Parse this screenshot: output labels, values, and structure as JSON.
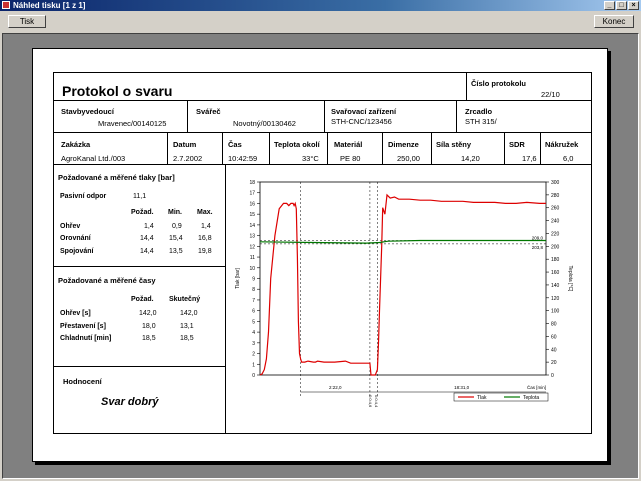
{
  "window": {
    "title": "Náhled tisku [1 z 1]",
    "print_btn": "Tisk",
    "close_btn": "Konec"
  },
  "doc": {
    "title": "Protokol o svaru",
    "protocol_no_label": "Číslo protokolu",
    "protocol_no": "22/10",
    "row1": [
      {
        "label": "Stavbyvedoucí",
        "value": "Mravenec/00140125"
      },
      {
        "label": "Svářeč",
        "value": "Novotný/00130462"
      },
      {
        "label": "Svařovací zařízení",
        "value": "STH-CNC/123456"
      },
      {
        "label": "Zrcadlo",
        "value": "STH 315/"
      }
    ],
    "row2": [
      {
        "label": "Zakázka",
        "value": "AgroKanal Ltd./003"
      },
      {
        "label": "Datum",
        "value": "2.7.2002"
      },
      {
        "label": "Čas",
        "value": "10:42:59"
      },
      {
        "label": "Teplota okolí",
        "value": "33°C"
      },
      {
        "label": "Materiál",
        "value": "PE 80"
      },
      {
        "label": "Dimenze",
        "value": "250,00"
      },
      {
        "label": "Síla stěny",
        "value": "14,20"
      },
      {
        "label": "SDR",
        "value": "17,6"
      },
      {
        "label": "Nákružek",
        "value": "6,0"
      }
    ],
    "pressures": {
      "title": "Požadované a měřené tlaky [bar]",
      "passive_label": "Pasivní odpor",
      "passive_value": "11,1",
      "headers": [
        "Požad.",
        "Min.",
        "Max."
      ],
      "rows": [
        {
          "name": "Ohřev",
          "vals": [
            "1,4",
            "0,9",
            "1,4"
          ]
        },
        {
          "name": "Orovnání",
          "vals": [
            "14,4",
            "15,4",
            "16,8"
          ]
        },
        {
          "name": "Spojování",
          "vals": [
            "14,4",
            "13,5",
            "19,8"
          ]
        }
      ]
    },
    "times": {
      "title": "Požadované a měřené časy",
      "headers": [
        "Požad.",
        "Skutečný"
      ],
      "rows": [
        {
          "name": "Ohřev [s]",
          "vals": [
            "142,0",
            "142,0"
          ]
        },
        {
          "name": "Přestavení [s]",
          "vals": [
            "18,0",
            "13,1"
          ]
        },
        {
          "name": "Chladnutí [min]",
          "vals": [
            "18,5",
            "18,5"
          ]
        }
      ]
    },
    "evaluation": {
      "title": "Hodnocení",
      "value": "Svar dobrý"
    }
  },
  "chart_data": {
    "type": "line",
    "ylabel": "Tlak [bar]",
    "y2label": "Teplota [°C]",
    "xlabel": "Čas [min]",
    "ylim": [
      0,
      18
    ],
    "y2lim": [
      0,
      300
    ],
    "yticks": [
      "0",
      "1",
      "2",
      "3",
      "4",
      "5",
      "6",
      "7",
      "8",
      "9",
      "10",
      "11",
      "12",
      "13",
      "14",
      "15",
      "16",
      "17",
      "18"
    ],
    "y2ticks": [
      "0",
      "20",
      "40",
      "60",
      "80",
      "100",
      "120",
      "140",
      "160",
      "180",
      "200",
      "220",
      "240",
      "260",
      "280",
      "300"
    ],
    "ref_labels": [
      "209,0",
      "203,8"
    ],
    "phase_labels": [
      "2:22,0",
      "0:0:4,6",
      "0:0:4,4",
      "18:31,0"
    ],
    "legend": [
      {
        "name": "Tlak",
        "color": "#dd0000"
      },
      {
        "name": "Teplota",
        "color": "#007700"
      }
    ],
    "series": [
      {
        "name": "Tlak",
        "color": "#dd0000",
        "x": [
          0,
          2,
          4,
          6,
          8,
          10,
          14,
          18,
          22,
          25,
          27,
          29,
          31,
          32,
          33,
          34,
          35,
          36,
          37,
          38,
          39,
          42,
          45,
          50,
          52,
          54,
          60,
          70,
          80,
          85,
          95,
          103,
          104,
          106,
          108,
          110,
          111,
          112,
          113,
          114,
          115,
          117,
          119,
          122,
          126,
          130,
          140,
          150,
          160,
          170,
          180,
          190,
          200,
          210,
          220,
          230,
          240,
          250,
          262,
          268
        ],
        "y": [
          0,
          0.1,
          0.5,
          1.5,
          4,
          9,
          13,
          15.5,
          16,
          16,
          15.8,
          16,
          16,
          15.8,
          16,
          15.5,
          11,
          5,
          2,
          1.5,
          1.2,
          1.2,
          1.3,
          1.2,
          1.2,
          1.3,
          1.2,
          1.2,
          1.3,
          1.1,
          1.1,
          1.1,
          0,
          0,
          0,
          0.5,
          3,
          6,
          9,
          12,
          15.6,
          15,
          16.8,
          16.5,
          16.6,
          16.4,
          16.4,
          16.3,
          16.3,
          16.2,
          16.2,
          16.2,
          16.1,
          16.1,
          16.1,
          16.0,
          16.0,
          16.1,
          16.0,
          16.0
        ]
      },
      {
        "name": "Teplota",
        "color": "#007700",
        "x": [
          0,
          50,
          100,
          112,
          120,
          150,
          200,
          268
        ],
        "y": [
          207,
          206,
          205,
          206,
          208,
          209,
          209,
          209
        ]
      }
    ]
  }
}
